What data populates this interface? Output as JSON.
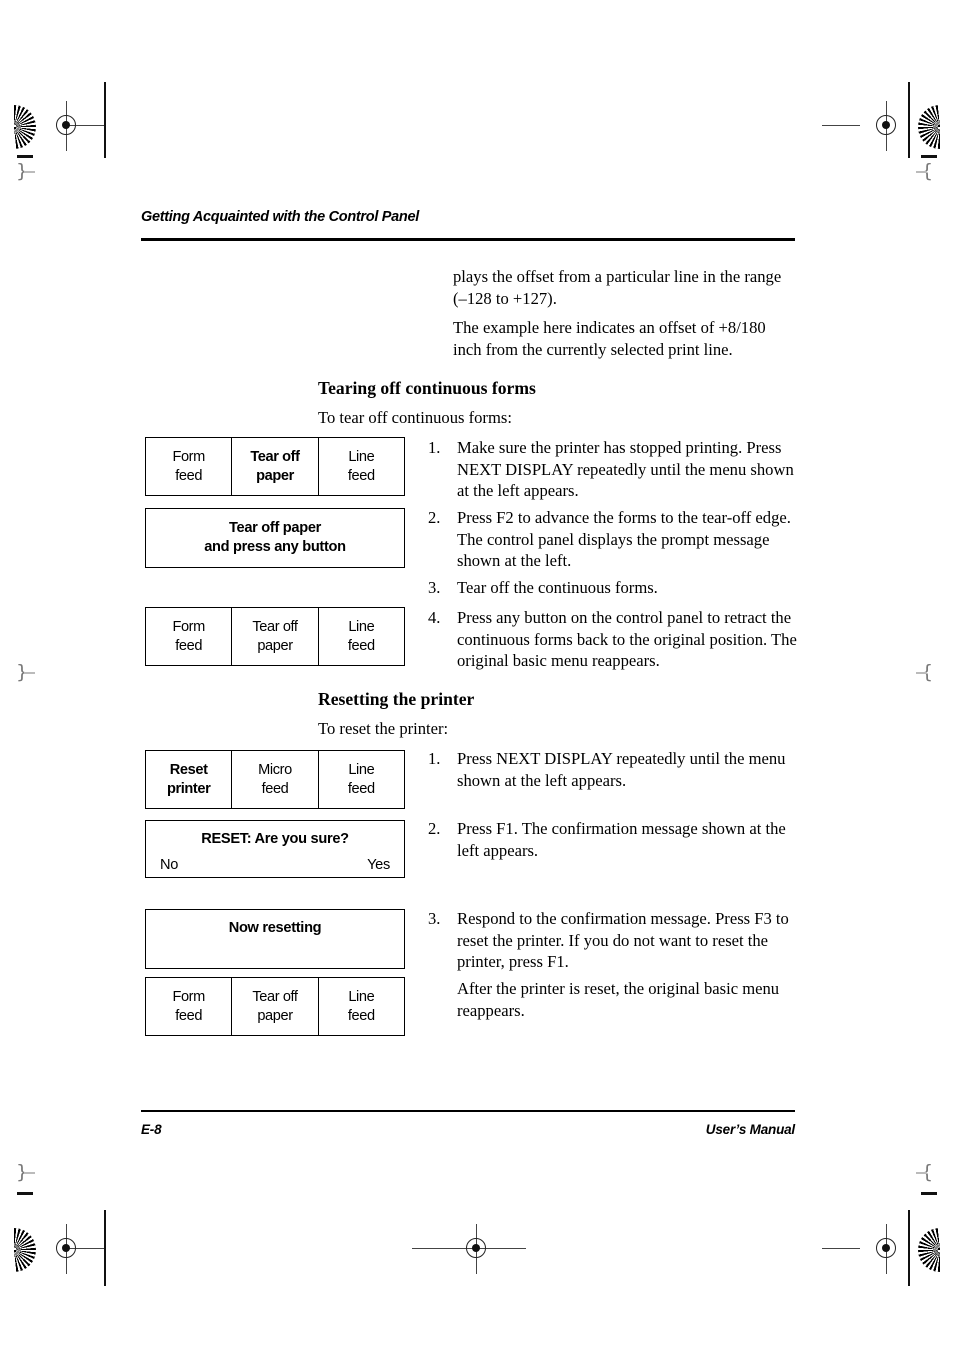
{
  "page": {
    "running_head": "Getting Acquainted with the Control Panel",
    "folio": "E-8",
    "footer_right": "User’s Manual"
  },
  "intro": {
    "para1": "plays the offset from a particular line in the range (–128 to +127).",
    "para2": "The example here indicates an offset of +8/180 inch from the currently selected print line."
  },
  "section_tearoff": {
    "heading": "Tearing off continuous forms",
    "lead": "To tear off continuous forms:",
    "steps": [
      {
        "num": "1.",
        "text": "Make sure the printer has stopped printing. Press NEXT DISPLAY repeatedly until the menu shown at the left appears."
      },
      {
        "num": "2.",
        "text": "Press F2 to advance the forms to the tear-off edge. The control panel displays the prompt message shown at the left."
      },
      {
        "num": "3.",
        "text": "Tear off the continuous forms."
      },
      {
        "num": "4.",
        "text": "Press any button on the control panel to retract the continuous forms back to the original position. The original basic menu reappears."
      }
    ],
    "menu_1": {
      "cells": [
        {
          "line1": "Form",
          "line2": "feed",
          "bold": false
        },
        {
          "line1": "Tear off",
          "line2": "paper",
          "bold": true
        },
        {
          "line1": "Line",
          "line2": "feed",
          "bold": false
        }
      ]
    },
    "prompt": {
      "line1": "Tear off paper",
      "line2": "and press any button"
    },
    "menu_2": {
      "cells": [
        {
          "line1": "Form",
          "line2": "feed",
          "bold": false
        },
        {
          "line1": "Tear off",
          "line2": "paper",
          "bold": false
        },
        {
          "line1": "Line",
          "line2": "feed",
          "bold": false
        }
      ]
    }
  },
  "section_reset": {
    "heading": "Resetting the printer",
    "lead": "To reset the printer:",
    "steps": [
      {
        "num": "1.",
        "text": "Press NEXT DISPLAY repeatedly until the menu shown at the left appears."
      },
      {
        "num": "2.",
        "text": "Press F1. The confirmation message shown at the left appears."
      },
      {
        "num": "3.",
        "text": "Respond to the confirmation message. Press F3 to reset the printer. If you do not want to reset the printer, press F1."
      }
    ],
    "after_note": "After the printer is reset, the original basic menu reappears.",
    "menu_1": {
      "cells": [
        {
          "line1": "Reset",
          "line2": "printer",
          "bold": true
        },
        {
          "line1": "Micro",
          "line2": "feed",
          "bold": false
        },
        {
          "line1": "Line",
          "line2": "feed",
          "bold": false
        }
      ]
    },
    "confirm": {
      "title": "RESET: Are you sure?",
      "option_left": "No",
      "option_right": "Yes"
    },
    "status": {
      "line1": "Now resetting"
    },
    "menu_2": {
      "cells": [
        {
          "line1": "Form",
          "line2": "feed",
          "bold": false
        },
        {
          "line1": "Tear off",
          "line2": "paper",
          "bold": false
        },
        {
          "line1": "Line",
          "line2": "feed",
          "bold": false
        }
      ]
    }
  },
  "marks": {
    "side_bracket_left": "}",
    "side_bracket_right": "{"
  }
}
